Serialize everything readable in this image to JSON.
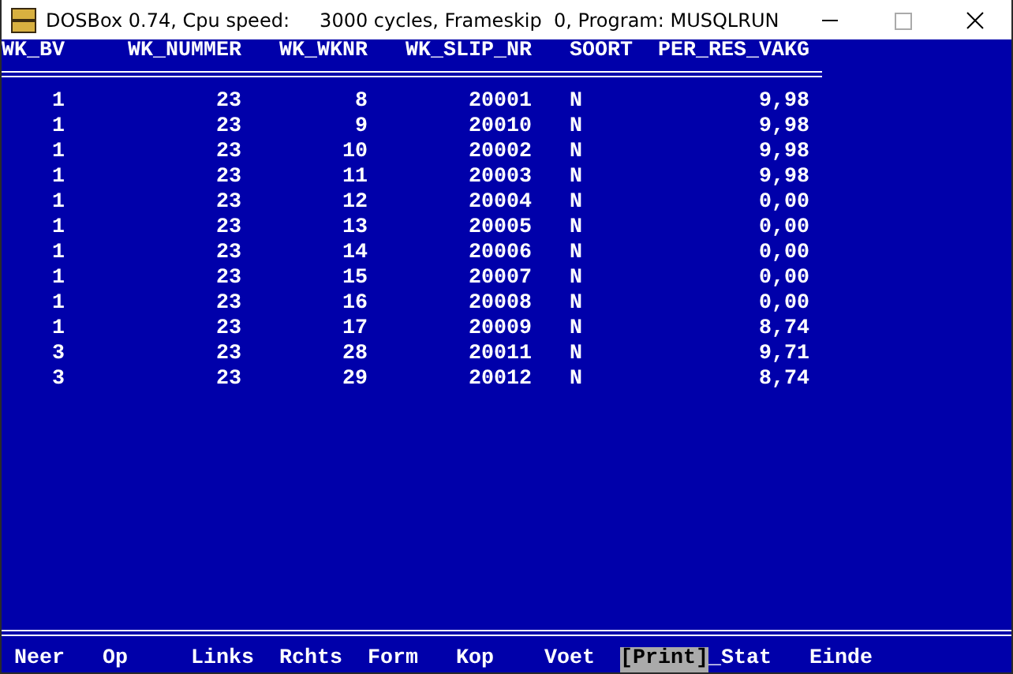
{
  "window": {
    "title": "DOSBox 0.74, Cpu speed:     3000 cycles, Frameskip  0, Program: MUSQLRUN"
  },
  "table": {
    "columns": [
      "WK_BV",
      "WK_NUMMER",
      "WK_WKNR",
      "WK_SLIP_NR",
      "SOORT",
      "PER_RES_VAKG"
    ],
    "rows": [
      [
        "1",
        "23",
        "8",
        "20001",
        "N",
        "9,98"
      ],
      [
        "1",
        "23",
        "9",
        "20010",
        "N",
        "9,98"
      ],
      [
        "1",
        "23",
        "10",
        "20002",
        "N",
        "9,98"
      ],
      [
        "1",
        "23",
        "11",
        "20003",
        "N",
        "9,98"
      ],
      [
        "1",
        "23",
        "12",
        "20004",
        "N",
        "0,00"
      ],
      [
        "1",
        "23",
        "13",
        "20005",
        "N",
        "0,00"
      ],
      [
        "1",
        "23",
        "14",
        "20006",
        "N",
        "0,00"
      ],
      [
        "1",
        "23",
        "15",
        "20007",
        "N",
        "0,00"
      ],
      [
        "1",
        "23",
        "16",
        "20008",
        "N",
        "0,00"
      ],
      [
        "1",
        "23",
        "17",
        "20009",
        "N",
        "8,74"
      ],
      [
        "3",
        "23",
        "28",
        "20011",
        "N",
        "9,71"
      ],
      [
        "3",
        "23",
        "29",
        "20012",
        "N",
        "8,74"
      ]
    ]
  },
  "menu": [
    {
      "label": "Neer",
      "selected": false
    },
    {
      "label": "Op",
      "selected": false
    },
    {
      "label": "Links",
      "selected": false
    },
    {
      "label": "Rchts",
      "selected": false
    },
    {
      "label": "Form",
      "selected": false
    },
    {
      "label": "Kop",
      "selected": false
    },
    {
      "label": "Voet",
      "selected": false
    },
    {
      "label": "[Print]",
      "selected": true
    },
    {
      "label": "_Stat",
      "selected": false
    },
    {
      "label": "Einde",
      "selected": false
    }
  ]
}
